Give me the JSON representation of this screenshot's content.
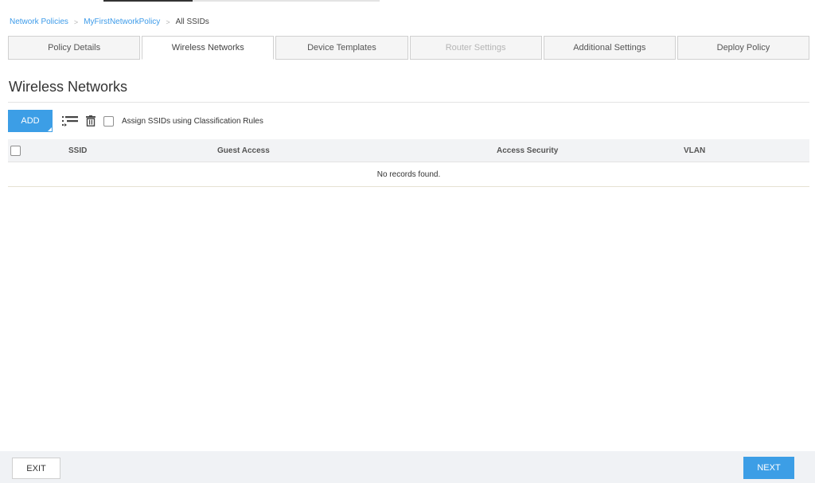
{
  "breadcrumb": {
    "items": [
      "Network Policies",
      "MyFirstNetworkPolicy"
    ],
    "current": "All SSIDs",
    "separator": ">"
  },
  "tabs": [
    {
      "label": "Policy Details",
      "state": "normal"
    },
    {
      "label": "Wireless Networks",
      "state": "active"
    },
    {
      "label": "Device Templates",
      "state": "normal"
    },
    {
      "label": "Router Settings",
      "state": "disabled"
    },
    {
      "label": "Additional Settings",
      "state": "normal"
    },
    {
      "label": "Deploy Policy",
      "state": "normal"
    }
  ],
  "page": {
    "title": "Wireless Networks"
  },
  "toolbar": {
    "add_label": "ADD",
    "reorder_icon": "list-reorder-icon",
    "delete_icon": "trash-icon",
    "assign_label": "Assign SSIDs using Classification Rules",
    "assign_checked": false
  },
  "table": {
    "columns": [
      "SSID",
      "Guest Access",
      "Access Security",
      "VLAN"
    ],
    "empty_message": "No records found.",
    "rows": []
  },
  "footer": {
    "exit_label": "EXIT",
    "next_label": "NEXT"
  },
  "colors": {
    "accent": "#3c9ee6",
    "link": "#3d9be9"
  }
}
